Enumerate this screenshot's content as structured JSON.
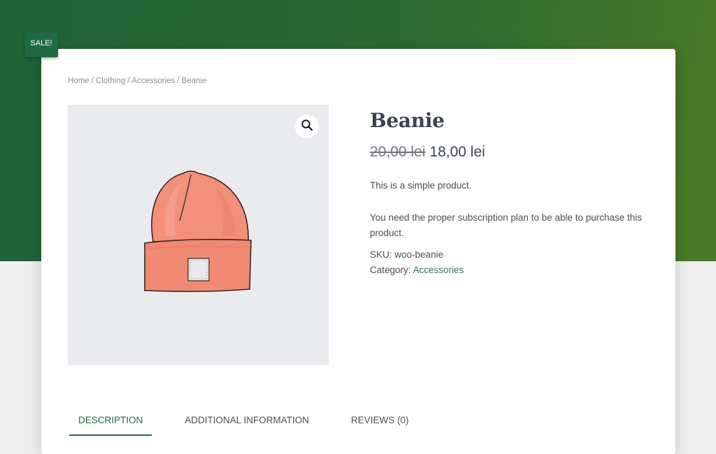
{
  "badge": {
    "sale_label": "SALE!"
  },
  "breadcrumb": {
    "items": [
      "Home",
      "Clothing",
      "Accessories"
    ],
    "separator": "/",
    "current": "Beanie"
  },
  "gallery": {
    "zoom_icon": "magnifier-icon",
    "image_alt": "Beanie"
  },
  "product": {
    "title": "Beanie",
    "price_old": "20,00 lei",
    "price_new": "18,00 lei",
    "short_description": "This is a simple product.",
    "subscription_notice": "You need the proper subscription plan to be able to purchase this product.",
    "sku_label": "SKU:",
    "sku": "woo-beanie",
    "category_label": "Category:",
    "category": "Accessories"
  },
  "tabs": [
    {
      "label": "DESCRIPTION",
      "active": true
    },
    {
      "label": "ADDITIONAL INFORMATION",
      "active": false
    },
    {
      "label": "REVIEWS (0)",
      "active": false
    }
  ],
  "colors": {
    "accent": "#1f6a43",
    "hero_start": "#1f6237",
    "hero_end": "#4a7a27",
    "link": "#2b7a55",
    "beanie": "#f08a73"
  }
}
